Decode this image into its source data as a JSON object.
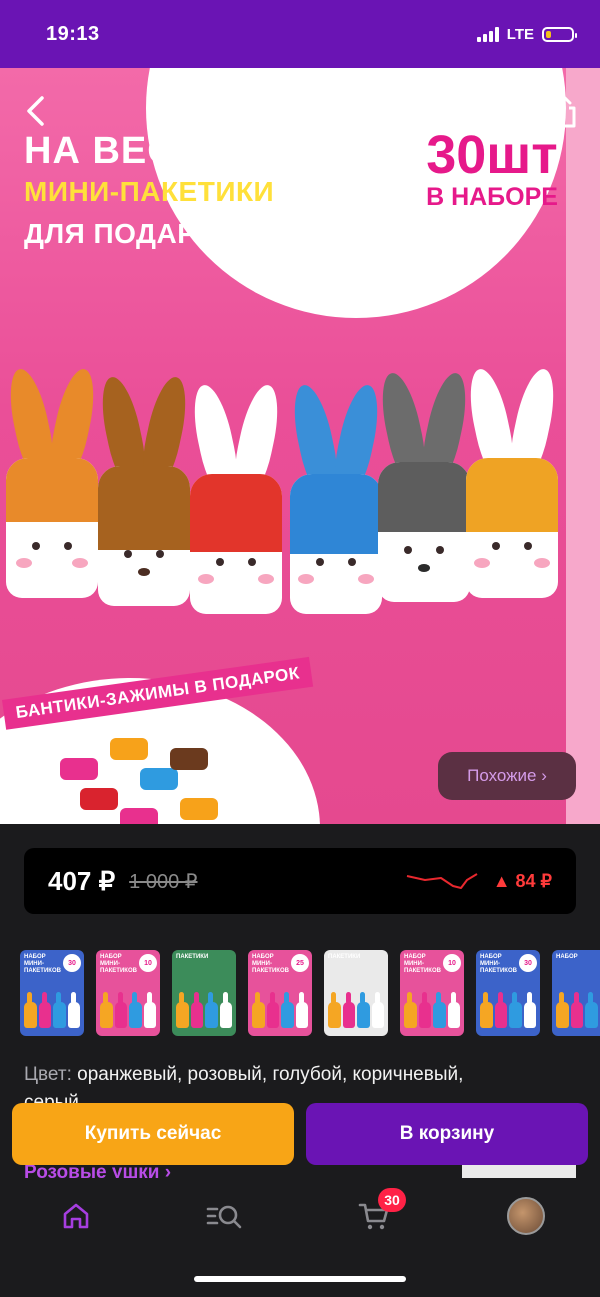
{
  "status_bar": {
    "time": "19:13",
    "network": "LTE",
    "battery_level": 0.2
  },
  "hero": {
    "title_line1": "НА ВЕСЬ КЛАСС",
    "title_line2": "МИНИ-ПАКЕТИКИ",
    "title_line3": "ДЛЯ ПОДАРКОВ",
    "pieces_count": "30шт",
    "pieces_label": "В НАБОРЕ",
    "ribbon_text": "БАНТИКИ-ЗАЖИМЫ В ПОДАРОК",
    "similar_button": "Похожие ›",
    "icons": {
      "back": "chevron-left-icon",
      "favorite": "heart-icon",
      "share": "share-icon"
    }
  },
  "price": {
    "current": "407 ₽",
    "old": "1 000 ₽",
    "change": "▲ 84 ₽",
    "change_color": "#ff3b3b"
  },
  "gallery": {
    "thumbnails": [
      {
        "title": "НАБОР МИНИ-ПАКЕТИКОВ",
        "badge": "30",
        "bg": "#3c63c9"
      },
      {
        "title": "НАБОР МИНИ-ПАКЕТИКОВ",
        "badge": "10",
        "bg": "#e7529b"
      },
      {
        "title": "ПАКЕТИКИ",
        "badge": "",
        "bg": "#3c8c5a"
      },
      {
        "title": "НАБОР МИНИ-ПАКЕТИКОВ",
        "badge": "25",
        "bg": "#e7529b"
      },
      {
        "title": "ПАКЕТИКИ",
        "badge": "",
        "bg": "#eaeaea"
      },
      {
        "title": "НАБОР МИНИ-ПАКЕТИКОВ",
        "badge": "10",
        "bg": "#e7529b"
      },
      {
        "title": "НАБОР МИНИ-ПАКЕТИКОВ",
        "badge": "30",
        "bg": "#3c63c9"
      },
      {
        "title": "НАБОР",
        "badge": "",
        "bg": "#3c63c9"
      }
    ]
  },
  "color": {
    "label": "Цвет:",
    "value": "оранжевый, розовый, голубой, коричневый,",
    "value_cont": "серый"
  },
  "actions": {
    "buy_now": "Купить сейчас",
    "add_to_cart": "В корзину"
  },
  "variant_link": "Розовые ушки ›",
  "bottom_nav": {
    "home": "home-icon",
    "catalog": "search-list-icon",
    "cart": "cart-icon",
    "cart_badge": "30",
    "profile": "avatar"
  },
  "colors": {
    "brand_purple": "#6a14b4",
    "buy_orange": "#f8a516",
    "badge_red": "#ff2246"
  }
}
